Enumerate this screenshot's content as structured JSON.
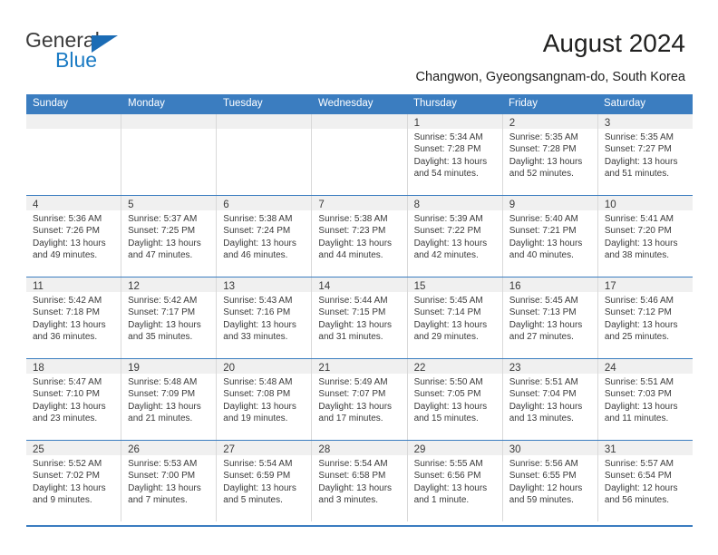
{
  "brand": {
    "name_part1": "General",
    "name_part2": "Blue",
    "accent_color": "#1b7bc4",
    "header_color": "#3b7dc0"
  },
  "header": {
    "title": "August 2024",
    "subtitle": "Changwon, Gyeongsangnam-do, South Korea"
  },
  "calendar": {
    "weekdays": [
      "Sunday",
      "Monday",
      "Tuesday",
      "Wednesday",
      "Thursday",
      "Friday",
      "Saturday"
    ],
    "weeks": [
      [
        {
          "day": "",
          "sunrise": "",
          "sunset": "",
          "daylight1": "",
          "daylight2": ""
        },
        {
          "day": "",
          "sunrise": "",
          "sunset": "",
          "daylight1": "",
          "daylight2": ""
        },
        {
          "day": "",
          "sunrise": "",
          "sunset": "",
          "daylight1": "",
          "daylight2": ""
        },
        {
          "day": "",
          "sunrise": "",
          "sunset": "",
          "daylight1": "",
          "daylight2": ""
        },
        {
          "day": "1",
          "sunrise": "Sunrise: 5:34 AM",
          "sunset": "Sunset: 7:28 PM",
          "daylight1": "Daylight: 13 hours",
          "daylight2": "and 54 minutes."
        },
        {
          "day": "2",
          "sunrise": "Sunrise: 5:35 AM",
          "sunset": "Sunset: 7:28 PM",
          "daylight1": "Daylight: 13 hours",
          "daylight2": "and 52 minutes."
        },
        {
          "day": "3",
          "sunrise": "Sunrise: 5:35 AM",
          "sunset": "Sunset: 7:27 PM",
          "daylight1": "Daylight: 13 hours",
          "daylight2": "and 51 minutes."
        }
      ],
      [
        {
          "day": "4",
          "sunrise": "Sunrise: 5:36 AM",
          "sunset": "Sunset: 7:26 PM",
          "daylight1": "Daylight: 13 hours",
          "daylight2": "and 49 minutes."
        },
        {
          "day": "5",
          "sunrise": "Sunrise: 5:37 AM",
          "sunset": "Sunset: 7:25 PM",
          "daylight1": "Daylight: 13 hours",
          "daylight2": "and 47 minutes."
        },
        {
          "day": "6",
          "sunrise": "Sunrise: 5:38 AM",
          "sunset": "Sunset: 7:24 PM",
          "daylight1": "Daylight: 13 hours",
          "daylight2": "and 46 minutes."
        },
        {
          "day": "7",
          "sunrise": "Sunrise: 5:38 AM",
          "sunset": "Sunset: 7:23 PM",
          "daylight1": "Daylight: 13 hours",
          "daylight2": "and 44 minutes."
        },
        {
          "day": "8",
          "sunrise": "Sunrise: 5:39 AM",
          "sunset": "Sunset: 7:22 PM",
          "daylight1": "Daylight: 13 hours",
          "daylight2": "and 42 minutes."
        },
        {
          "day": "9",
          "sunrise": "Sunrise: 5:40 AM",
          "sunset": "Sunset: 7:21 PM",
          "daylight1": "Daylight: 13 hours",
          "daylight2": "and 40 minutes."
        },
        {
          "day": "10",
          "sunrise": "Sunrise: 5:41 AM",
          "sunset": "Sunset: 7:20 PM",
          "daylight1": "Daylight: 13 hours",
          "daylight2": "and 38 minutes."
        }
      ],
      [
        {
          "day": "11",
          "sunrise": "Sunrise: 5:42 AM",
          "sunset": "Sunset: 7:18 PM",
          "daylight1": "Daylight: 13 hours",
          "daylight2": "and 36 minutes."
        },
        {
          "day": "12",
          "sunrise": "Sunrise: 5:42 AM",
          "sunset": "Sunset: 7:17 PM",
          "daylight1": "Daylight: 13 hours",
          "daylight2": "and 35 minutes."
        },
        {
          "day": "13",
          "sunrise": "Sunrise: 5:43 AM",
          "sunset": "Sunset: 7:16 PM",
          "daylight1": "Daylight: 13 hours",
          "daylight2": "and 33 minutes."
        },
        {
          "day": "14",
          "sunrise": "Sunrise: 5:44 AM",
          "sunset": "Sunset: 7:15 PM",
          "daylight1": "Daylight: 13 hours",
          "daylight2": "and 31 minutes."
        },
        {
          "day": "15",
          "sunrise": "Sunrise: 5:45 AM",
          "sunset": "Sunset: 7:14 PM",
          "daylight1": "Daylight: 13 hours",
          "daylight2": "and 29 minutes."
        },
        {
          "day": "16",
          "sunrise": "Sunrise: 5:45 AM",
          "sunset": "Sunset: 7:13 PM",
          "daylight1": "Daylight: 13 hours",
          "daylight2": "and 27 minutes."
        },
        {
          "day": "17",
          "sunrise": "Sunrise: 5:46 AM",
          "sunset": "Sunset: 7:12 PM",
          "daylight1": "Daylight: 13 hours",
          "daylight2": "and 25 minutes."
        }
      ],
      [
        {
          "day": "18",
          "sunrise": "Sunrise: 5:47 AM",
          "sunset": "Sunset: 7:10 PM",
          "daylight1": "Daylight: 13 hours",
          "daylight2": "and 23 minutes."
        },
        {
          "day": "19",
          "sunrise": "Sunrise: 5:48 AM",
          "sunset": "Sunset: 7:09 PM",
          "daylight1": "Daylight: 13 hours",
          "daylight2": "and 21 minutes."
        },
        {
          "day": "20",
          "sunrise": "Sunrise: 5:48 AM",
          "sunset": "Sunset: 7:08 PM",
          "daylight1": "Daylight: 13 hours",
          "daylight2": "and 19 minutes."
        },
        {
          "day": "21",
          "sunrise": "Sunrise: 5:49 AM",
          "sunset": "Sunset: 7:07 PM",
          "daylight1": "Daylight: 13 hours",
          "daylight2": "and 17 minutes."
        },
        {
          "day": "22",
          "sunrise": "Sunrise: 5:50 AM",
          "sunset": "Sunset: 7:05 PM",
          "daylight1": "Daylight: 13 hours",
          "daylight2": "and 15 minutes."
        },
        {
          "day": "23",
          "sunrise": "Sunrise: 5:51 AM",
          "sunset": "Sunset: 7:04 PM",
          "daylight1": "Daylight: 13 hours",
          "daylight2": "and 13 minutes."
        },
        {
          "day": "24",
          "sunrise": "Sunrise: 5:51 AM",
          "sunset": "Sunset: 7:03 PM",
          "daylight1": "Daylight: 13 hours",
          "daylight2": "and 11 minutes."
        }
      ],
      [
        {
          "day": "25",
          "sunrise": "Sunrise: 5:52 AM",
          "sunset": "Sunset: 7:02 PM",
          "daylight1": "Daylight: 13 hours",
          "daylight2": "and 9 minutes."
        },
        {
          "day": "26",
          "sunrise": "Sunrise: 5:53 AM",
          "sunset": "Sunset: 7:00 PM",
          "daylight1": "Daylight: 13 hours",
          "daylight2": "and 7 minutes."
        },
        {
          "day": "27",
          "sunrise": "Sunrise: 5:54 AM",
          "sunset": "Sunset: 6:59 PM",
          "daylight1": "Daylight: 13 hours",
          "daylight2": "and 5 minutes."
        },
        {
          "day": "28",
          "sunrise": "Sunrise: 5:54 AM",
          "sunset": "Sunset: 6:58 PM",
          "daylight1": "Daylight: 13 hours",
          "daylight2": "and 3 minutes."
        },
        {
          "day": "29",
          "sunrise": "Sunrise: 5:55 AM",
          "sunset": "Sunset: 6:56 PM",
          "daylight1": "Daylight: 13 hours",
          "daylight2": "and 1 minute."
        },
        {
          "day": "30",
          "sunrise": "Sunrise: 5:56 AM",
          "sunset": "Sunset: 6:55 PM",
          "daylight1": "Daylight: 12 hours",
          "daylight2": "and 59 minutes."
        },
        {
          "day": "31",
          "sunrise": "Sunrise: 5:57 AM",
          "sunset": "Sunset: 6:54 PM",
          "daylight1": "Daylight: 12 hours",
          "daylight2": "and 56 minutes."
        }
      ]
    ]
  }
}
